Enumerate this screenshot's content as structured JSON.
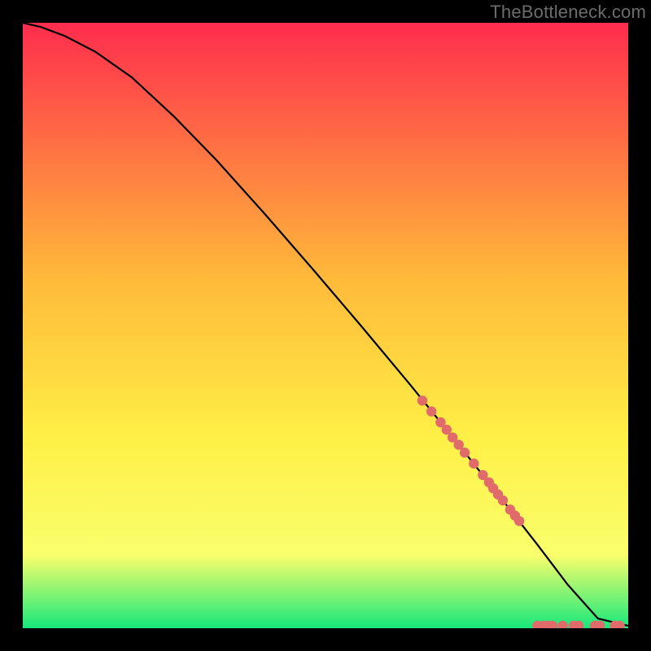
{
  "watermark": "TheBottleneck.com",
  "colors": {
    "bg": "#000000",
    "gradient_top": "#ff2c4d",
    "gradient_mid1": "#ffb93a",
    "gradient_mid2": "#ffef46",
    "gradient_mid3": "#f9ff6c",
    "gradient_bottom": "#17e87b",
    "curve": "#000000",
    "marker_fill": "#e16a6a",
    "marker_stroke": "#c94f4f"
  },
  "chart_data": {
    "type": "line",
    "title": "",
    "xlabel": "",
    "ylabel": "",
    "xlim": [
      0,
      100
    ],
    "ylim": [
      0,
      100
    ],
    "curve": {
      "x": [
        0,
        3,
        7,
        12,
        18,
        25,
        32,
        40,
        48,
        56,
        64,
        72,
        80,
        85,
        90,
        95,
        100
      ],
      "y": [
        100,
        99.3,
        97.8,
        95.2,
        91.0,
        84.5,
        77.3,
        68.4,
        59.2,
        49.8,
        40.2,
        30.3,
        20.2,
        13.8,
        7.2,
        1.6,
        0.4
      ]
    },
    "markers": {
      "x": [
        66,
        67.5,
        69,
        70,
        71,
        72,
        73,
        74.5,
        76,
        77,
        77.7,
        78.5,
        79.3,
        80.5,
        81.3,
        82,
        85,
        86,
        86.8,
        87.5,
        89.2,
        91,
        91.8,
        94.5,
        95.3,
        97.8,
        98.6
      ],
      "y": [
        37.6,
        35.8,
        34.0,
        32.8,
        31.5,
        30.3,
        29.0,
        27.2,
        25.3,
        24.1,
        23.1,
        22.1,
        21.1,
        19.6,
        18.6,
        17.7,
        0.4,
        0.4,
        0.4,
        0.4,
        0.4,
        0.4,
        0.4,
        0.4,
        0.4,
        0.4,
        0.4
      ]
    }
  }
}
